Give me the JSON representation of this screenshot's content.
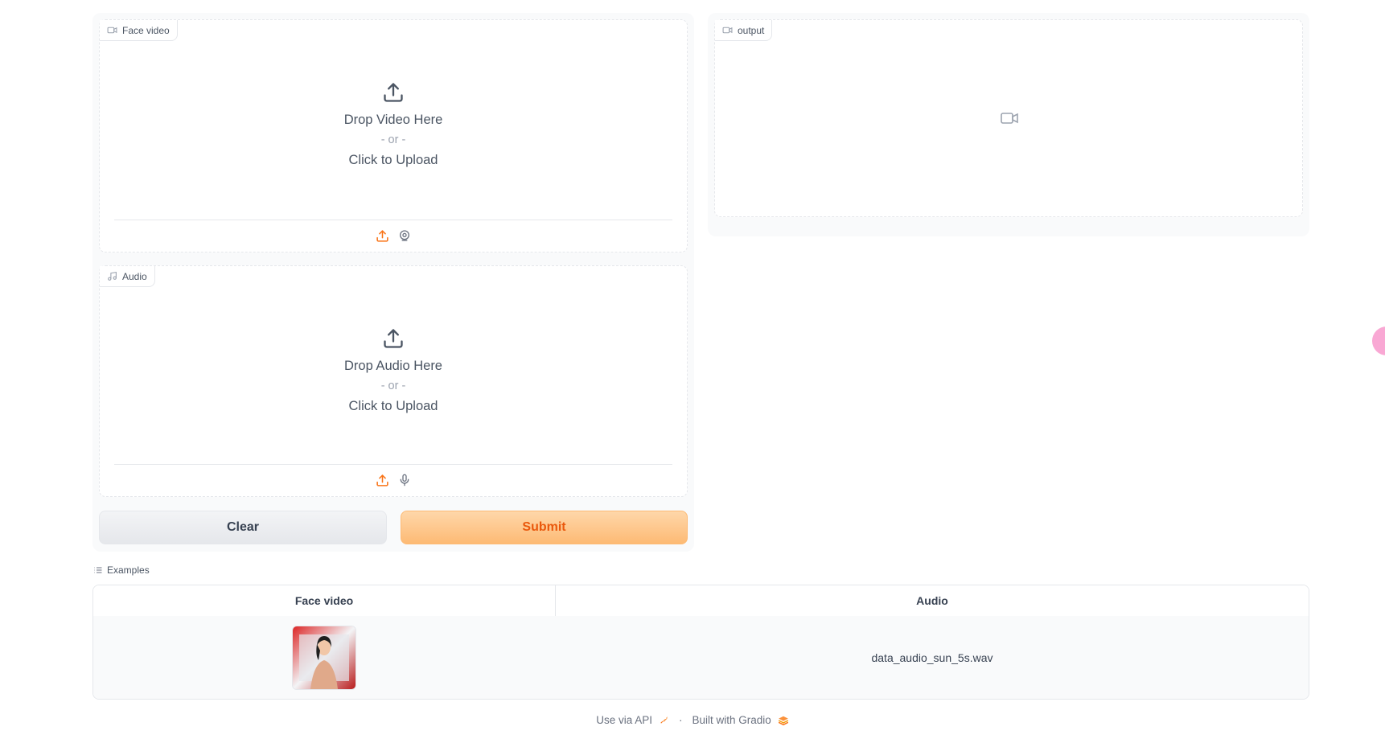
{
  "inputs": {
    "face_video": {
      "label": "Face video",
      "drop_text": "Drop Video Here",
      "or_text": "- or -",
      "click_text": "Click to Upload"
    },
    "audio": {
      "label": "Audio",
      "drop_text": "Drop Audio Here",
      "or_text": "- or -",
      "click_text": "Click to Upload"
    }
  },
  "buttons": {
    "clear_label": "Clear",
    "submit_label": "Submit"
  },
  "output": {
    "label": "output"
  },
  "examples": {
    "title": "Examples",
    "headers": [
      "Face video",
      "Audio"
    ],
    "rows": [
      {
        "face_video": "thumbnail",
        "audio": "data_audio_sun_5s.wav"
      }
    ]
  },
  "footer": {
    "api_text": "Use via API",
    "separator": "·",
    "built_text": "Built with Gradio"
  },
  "colors": {
    "accent": "#f97316",
    "submit_bg": "#fdba74",
    "submit_text": "#ea580c"
  }
}
